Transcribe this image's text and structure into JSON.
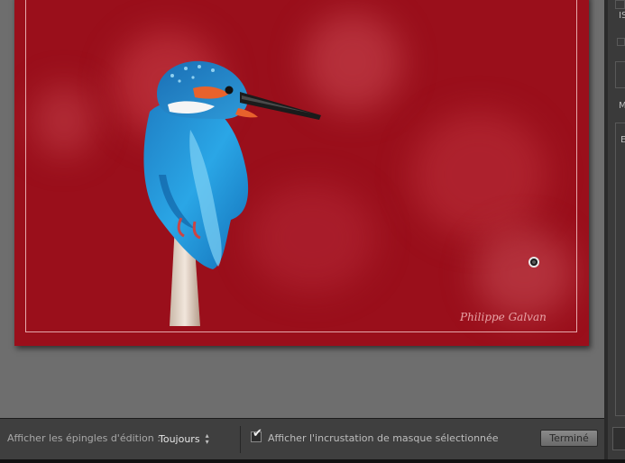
{
  "photo": {
    "signature": "Philippe Galvan",
    "subject": "kingfisher-on-reed",
    "background_color": "#9a0f1b"
  },
  "toolbar": {
    "pins_label": "Afficher les épingles d'édition :",
    "pins_value": "Toujours",
    "mask_overlay_checked": true,
    "mask_overlay_label": "Afficher l'incrustation de masque sélectionnée",
    "done_label": "Terminé"
  },
  "right_panel": {
    "letters": [
      "IS",
      "M",
      "E"
    ]
  },
  "colors": {
    "canvas": "#6e6e6e",
    "toolbar": "#3f3f3f",
    "panel": "#3a3a3a"
  }
}
